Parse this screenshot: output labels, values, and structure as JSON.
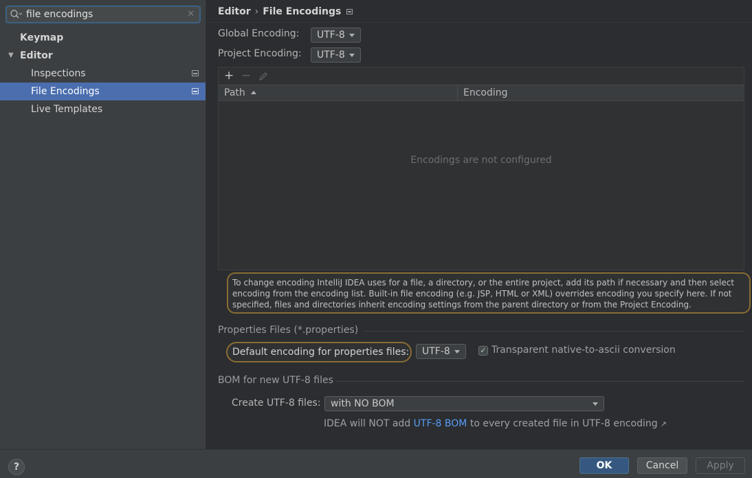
{
  "search": {
    "value": "file encodings",
    "icon": "search-icon"
  },
  "sidebar": {
    "items": [
      {
        "label": "Keymap"
      },
      {
        "label": "Editor"
      },
      {
        "label": "Inspections"
      },
      {
        "label": "File Encodings"
      },
      {
        "label": "Live Templates"
      }
    ],
    "selected": "File Encodings"
  },
  "breadcrumb": {
    "parent": "Editor",
    "separator": "›",
    "current": "File Encodings"
  },
  "global_encoding": {
    "label": "Global Encoding:",
    "value": "UTF-8"
  },
  "project_encoding": {
    "label": "Project Encoding:",
    "value": "UTF-8"
  },
  "table": {
    "toolbar": {
      "add": "+",
      "remove": "−"
    },
    "columns": [
      "Path",
      "Encoding"
    ],
    "empty_text": "Encodings are not configured"
  },
  "info_text": "To change encoding IntelliJ IDEA uses for a file, a directory, or the entire project, add its path if necessary and then select encoding from the encoding list. Built-in file encoding (e.g. JSP, HTML or XML) overrides encoding you specify here. If not specified, files and directories inherit encoding settings from the parent directory or from the Project Encoding.",
  "properties": {
    "group_title": "Properties Files (*.properties)",
    "default_label": "Default encoding for properties files:",
    "default_value": "UTF-8",
    "checkbox_label": "Transparent native-to-ascii conversion",
    "checkbox_checked": true
  },
  "bom": {
    "group_title": "BOM for new UTF-8 files",
    "create_label": "Create UTF-8 files:",
    "create_value": "with NO BOM",
    "note_before": "IDEA will NOT add ",
    "note_link": "UTF-8 BOM",
    "note_after": " to every created file in UTF-8 encoding",
    "note_ext": "↗"
  },
  "footer": {
    "help": "?",
    "ok": "OK",
    "cancel": "Cancel",
    "apply": "Apply"
  },
  "colors": {
    "selection": "#4b6eaf",
    "highlight_border": "#8a6d32",
    "link": "#589df6",
    "ok_button": "#365880"
  }
}
